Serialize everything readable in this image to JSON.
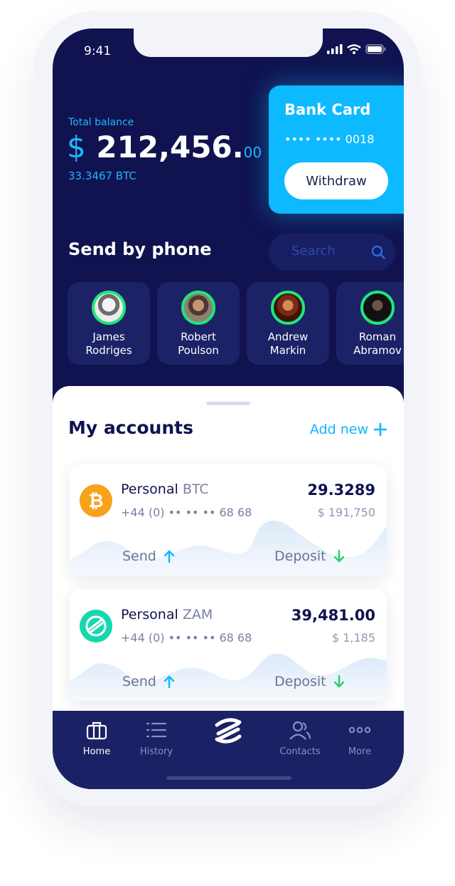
{
  "status": {
    "time": "9:41"
  },
  "balance": {
    "label": "Total balance",
    "currency": "$",
    "amount": "212,456.",
    "cents": "00",
    "btc": "33.3467 BTC"
  },
  "bank_card": {
    "title": "Bank Card",
    "masked_number": "•••• ••••  0018",
    "withdraw_label": "Withdraw"
  },
  "send_by_phone": {
    "title": "Send by phone",
    "search_placeholder": "Search"
  },
  "contacts": [
    {
      "first": "James",
      "last": "Rodriges"
    },
    {
      "first": "Robert",
      "last": "Poulson"
    },
    {
      "first": "Andrew",
      "last": "Markin"
    },
    {
      "first": "Roman",
      "last": "Abramov"
    }
  ],
  "accounts": {
    "title": "My accounts",
    "add_new_label": "Add new",
    "items": [
      {
        "name": "Personal",
        "ticker": "BTC",
        "phone": "+44 (0) •• •• ••  68 68",
        "amount": "29.3289",
        "fiat": "$ 191,750",
        "send_label": "Send",
        "deposit_label": "Deposit",
        "coin_color": "#f7a21b"
      },
      {
        "name": "Personal",
        "ticker": "ZAM",
        "phone": "+44 (0) •• •• ••  68 68",
        "amount": "39,481.00",
        "fiat": "$ 1,185",
        "send_label": "Send",
        "deposit_label": "Deposit",
        "coin_color": "#16d8ae"
      }
    ]
  },
  "tabbar": {
    "home": "Home",
    "history": "History",
    "contacts": "Contacts",
    "more": "More"
  },
  "colors": {
    "navy": "#10134f",
    "accent": "#10b4ff",
    "avatar_ring": "#1fe77a",
    "deposit_arrow": "#25d366"
  }
}
